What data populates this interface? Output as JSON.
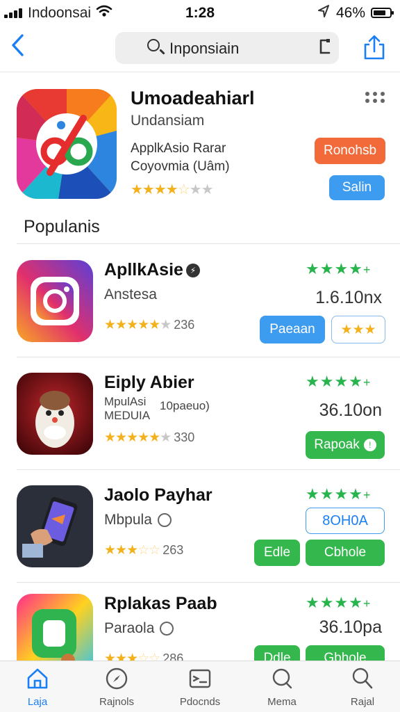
{
  "status": {
    "carrier": "Indoonsai",
    "time": "1:28",
    "battery": "46%"
  },
  "nav": {
    "search_text": "Inponsiain",
    "back_icon": "chevron-left-icon",
    "share_icon": "share-icon"
  },
  "featured": {
    "title": "Umoadeahiarl",
    "subtitle": "Undansiam",
    "desc_line1": "ApplkAsio Rarar",
    "desc_line2": "Coyovmia (Uâm)",
    "rating": 3.5,
    "button_primary": "Ronohsb",
    "button_secondary": "Salin"
  },
  "section_title": "Populanis",
  "apps": [
    {
      "title": "ApllkAsie",
      "subtitle": "Anstesa",
      "rating_count": "236",
      "size": "1.6.10nx",
      "button1": "Paeaan",
      "button2": "★★★"
    },
    {
      "title": "Eiply Abier",
      "subtitle_line1": "MpulAsi",
      "subtitle_line2": "MEDUIA",
      "subtitle_extra": "10paeuo)",
      "rating_count": "330",
      "size": "36.10on",
      "button1": "Rapoak"
    },
    {
      "title": "Jaolo Payhar",
      "subtitle": "Mbpula",
      "rating_count": "263",
      "size_button": "8OH0A",
      "button1": "Edle",
      "button2": "Cbhole"
    },
    {
      "title": "Rplakas Paab",
      "subtitle": "Paraola",
      "rating_count": "286",
      "size": "36.10pa",
      "button1": "Ddle",
      "button2": "Gbhole"
    }
  ],
  "tabs": [
    {
      "label": "Laja",
      "icon": "home-icon"
    },
    {
      "label": "Rajnols",
      "icon": "compass-icon"
    },
    {
      "label": "Pdocnds",
      "icon": "card-icon"
    },
    {
      "label": "Mema",
      "icon": "search-bubble-icon"
    },
    {
      "label": "Rajal",
      "icon": "search-icon"
    }
  ],
  "colors": {
    "accent": "#1a7ff5",
    "orange": "#f26a3a",
    "green": "#28b44c",
    "star": "#f3b21c"
  }
}
